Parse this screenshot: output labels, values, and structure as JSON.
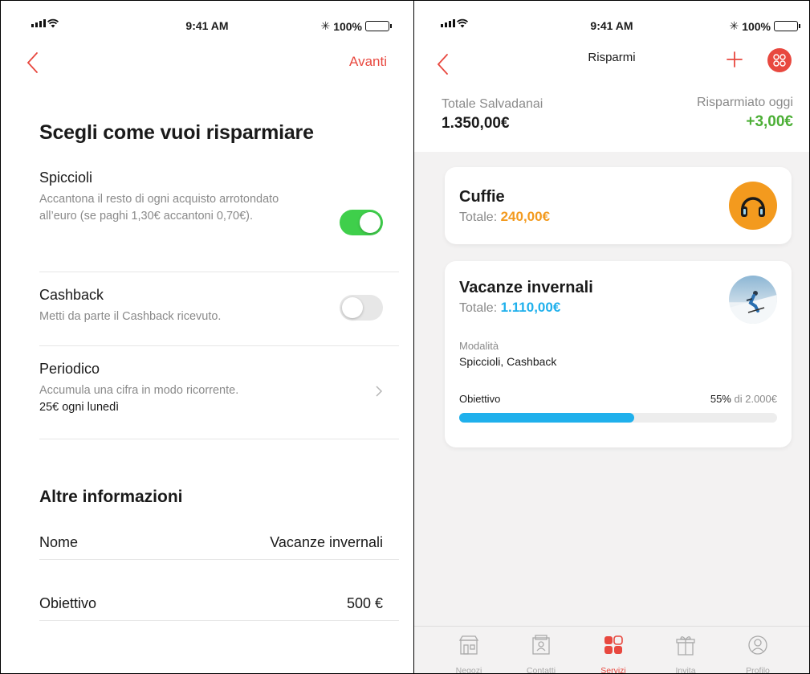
{
  "status_bar": {
    "time": "9:41 AM",
    "battery": "100%"
  },
  "left": {
    "nav_action": "Avanti",
    "title": "Scegli come vuoi risparmiare",
    "options": [
      {
        "title": "Spiccioli",
        "desc": "Accantona il resto di ogni acquisto arrotondato all’euro (se paghi 1,30€ accantoni 0,70€).",
        "enabled": true
      },
      {
        "title": "Cashback",
        "desc": "Metti da parte il Cashback ricevuto.",
        "enabled": false
      },
      {
        "title": "Periodico",
        "desc": "Accumula una cifra in modo ricorrente.",
        "extra": "25€ ogni lunedì"
      }
    ],
    "section_title": "Altre informazioni",
    "fields": [
      {
        "label": "Nome",
        "value": "Vacanze invernali"
      },
      {
        "label": "Obiettivo",
        "value": "500 €"
      }
    ]
  },
  "right": {
    "title": "Risparmi",
    "total_label": "Totale Salvadanai",
    "total_value": "1.350,00€",
    "today_label": "Risparmiato oggi",
    "today_value": "+3,00€",
    "cards": [
      {
        "name": "Cuffie",
        "total_label": "Totale:",
        "total_value": "240,00€",
        "accent": "#f39a1e",
        "icon": "headphones-icon"
      },
      {
        "name": "Vacanze invernali",
        "total_label": "Totale:",
        "total_value": "1.110,00€",
        "accent": "#1fb0ec",
        "icon": "skier-photo",
        "mode_label": "Modalità",
        "mode_value": "Spiccioli, Cashback",
        "goal_label": "Obiettivo",
        "goal_percent": "55%",
        "goal_rest": "di 2.000€",
        "progress": 0.55
      }
    ],
    "tabs": [
      {
        "label": "Negozi",
        "icon": "store-icon",
        "active": false
      },
      {
        "label": "Contatti",
        "icon": "contacts-icon",
        "active": false
      },
      {
        "label": "Servizi",
        "icon": "services-icon",
        "active": true
      },
      {
        "label": "Invita",
        "icon": "gift-icon",
        "active": false
      },
      {
        "label": "Profilo",
        "icon": "profile-icon",
        "active": false
      }
    ]
  },
  "colors": {
    "accent": "#e8483f",
    "green": "#4caf36",
    "toggle_on": "#3fcf4b",
    "progress": "#1fb0ec",
    "orange": "#f39a1e"
  }
}
